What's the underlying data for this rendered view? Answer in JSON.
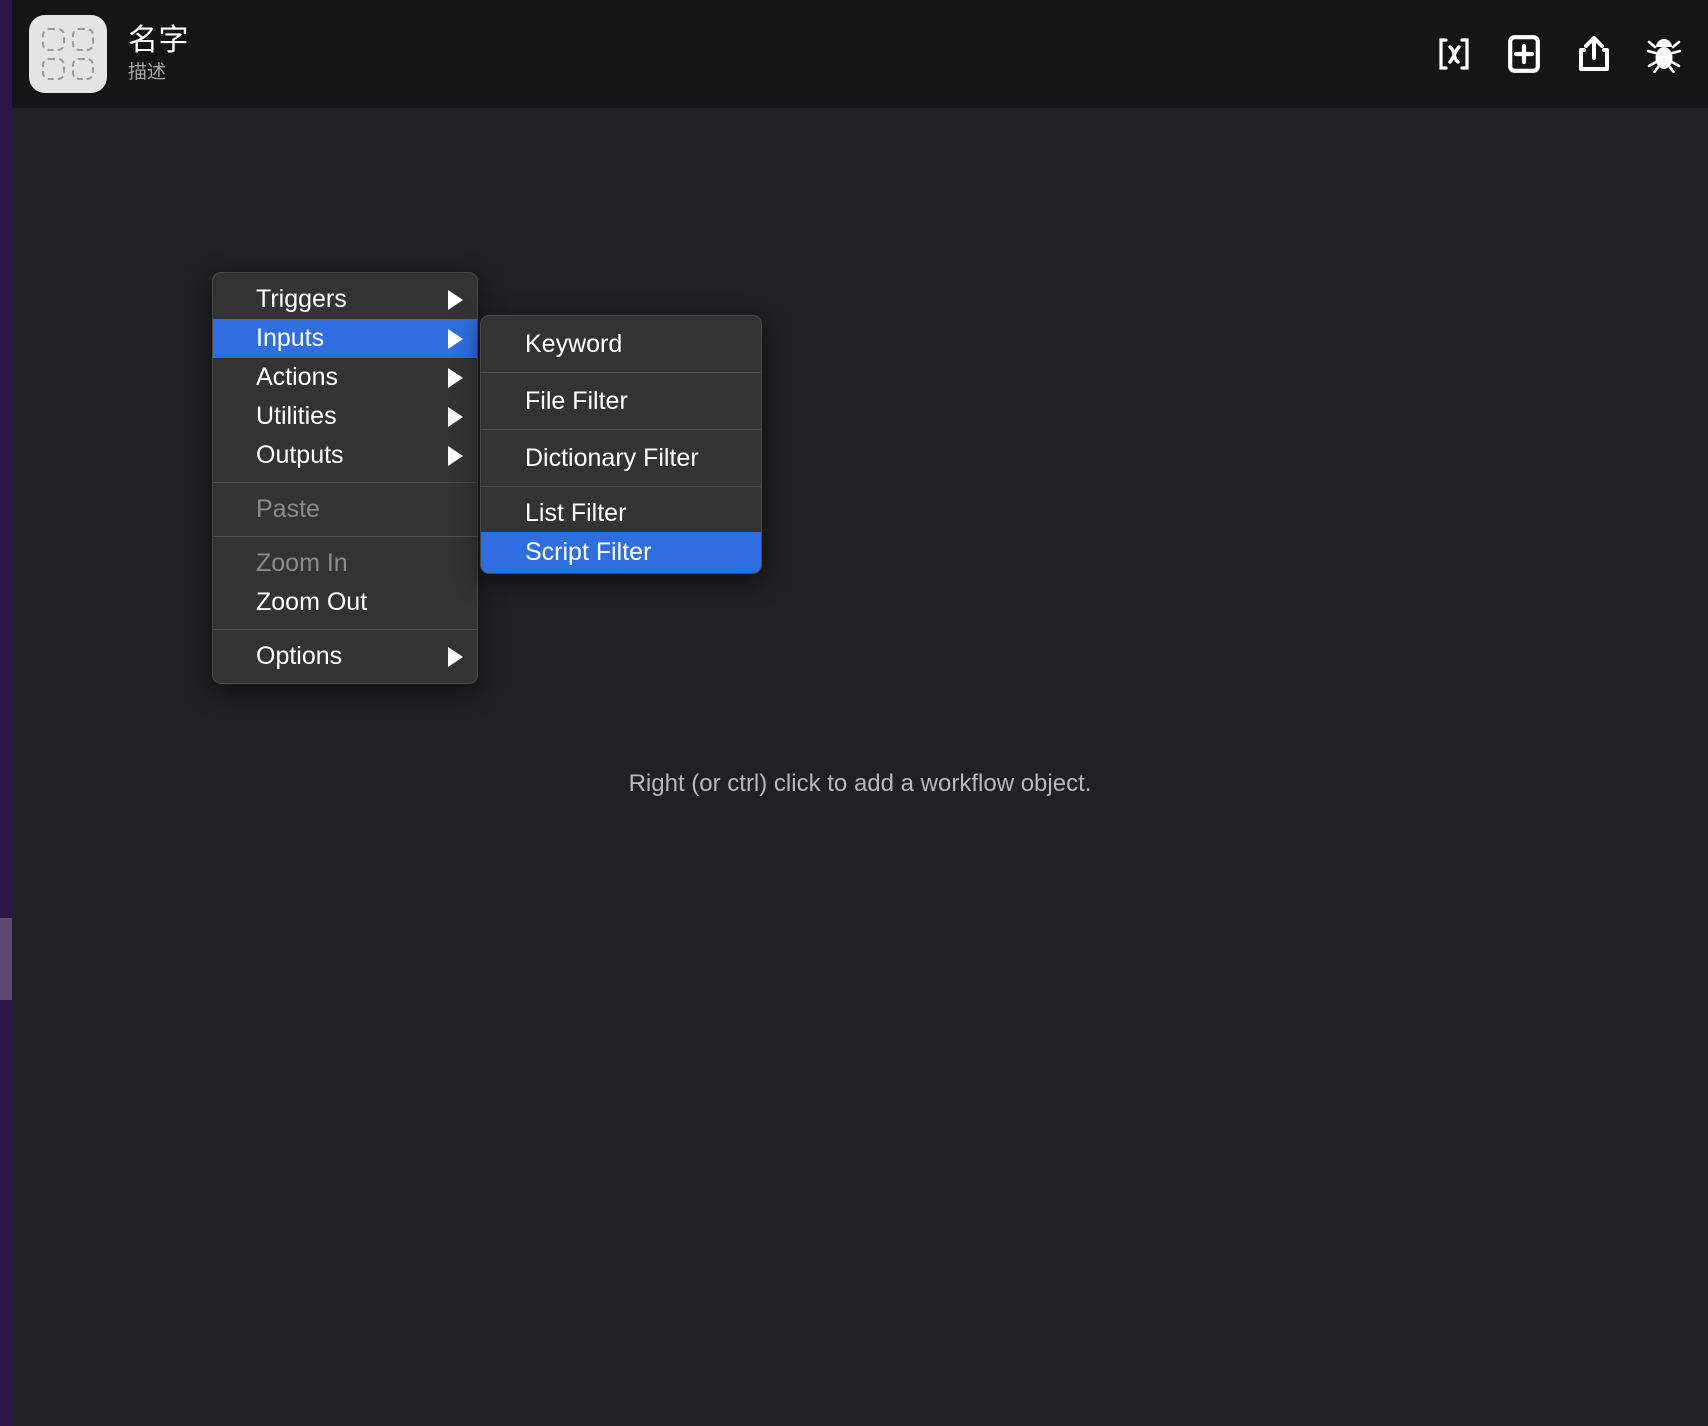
{
  "app": {
    "header": {
      "icon_name": "workflow-placeholder-icon",
      "title": "名字",
      "subtitle": "描述",
      "actions": [
        {
          "name": "variables-icon",
          "label": "[x]"
        },
        {
          "name": "add-note-icon",
          "label": "+"
        },
        {
          "name": "share-icon",
          "label": "Share"
        },
        {
          "name": "debug-icon",
          "label": "Debug"
        }
      ]
    },
    "canvas": {
      "hint": "Right (or ctrl) click to add a workflow object."
    },
    "colors": {
      "header_bg": "#151515",
      "canvas_bg": "#212123",
      "menu_bg": "#333334",
      "menu_separator": "#4e4e50",
      "highlight": "#2f6ee0",
      "gutter": "#2c1649",
      "gutter_thumb": "#5d4874",
      "disabled_text": "#8b8b8d"
    },
    "context_menu": {
      "groups": [
        {
          "items": [
            {
              "label": "Triggers",
              "submenu": true,
              "disabled": false,
              "selected": false
            },
            {
              "label": "Inputs",
              "submenu": true,
              "disabled": false,
              "selected": true
            },
            {
              "label": "Actions",
              "submenu": true,
              "disabled": false,
              "selected": false
            },
            {
              "label": "Utilities",
              "submenu": true,
              "disabled": false,
              "selected": false
            },
            {
              "label": "Outputs",
              "submenu": true,
              "disabled": false,
              "selected": false
            }
          ]
        },
        {
          "items": [
            {
              "label": "Paste",
              "submenu": false,
              "disabled": true,
              "selected": false
            }
          ]
        },
        {
          "items": [
            {
              "label": "Zoom In",
              "submenu": false,
              "disabled": true,
              "selected": false
            },
            {
              "label": "Zoom Out",
              "submenu": false,
              "disabled": false,
              "selected": false
            }
          ]
        },
        {
          "items": [
            {
              "label": "Options",
              "submenu": true,
              "disabled": false,
              "selected": false
            }
          ]
        }
      ]
    },
    "submenu": {
      "parent": "Inputs",
      "groups": [
        {
          "items": [
            {
              "label": "Keyword",
              "selected": false
            }
          ]
        },
        {
          "items": [
            {
              "label": "File Filter",
              "selected": false
            }
          ]
        },
        {
          "items": [
            {
              "label": "Dictionary Filter",
              "selected": false
            }
          ]
        },
        {
          "items": [
            {
              "label": "List Filter",
              "selected": false
            },
            {
              "label": "Script Filter",
              "selected": true
            }
          ]
        }
      ]
    }
  }
}
